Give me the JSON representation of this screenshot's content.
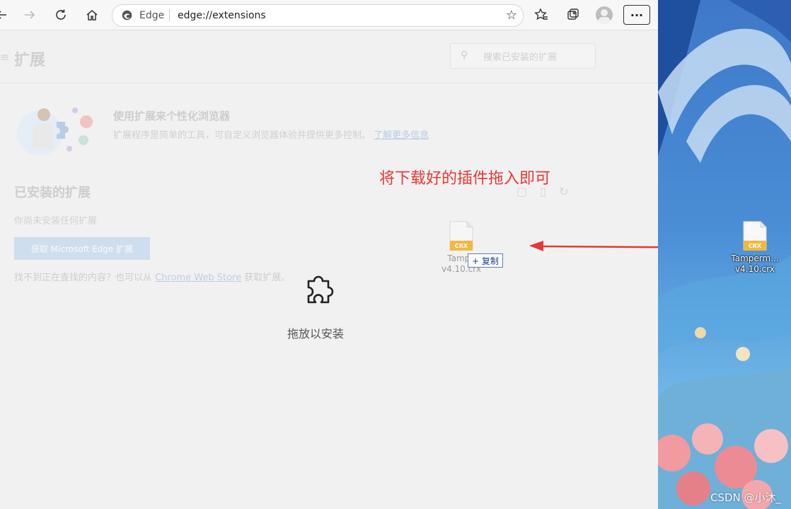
{
  "toolbar": {
    "edge_label": "Edge",
    "url": "edge://extensions",
    "more_label": "···"
  },
  "page": {
    "title": "扩展",
    "search_placeholder": "搜索已安装的扩展",
    "promo_title": "使用扩展来个性化浏览器",
    "promo_desc": "扩展程序是简单的工具，可自定义浏览器体验并提供更多控制。",
    "promo_link": "了解更多信息",
    "installed_title": "已安装的扩展",
    "none_installed": "你尚未安装任何扩展",
    "get_button": "获取 Microsoft Edge 扩展",
    "cant_find_prefix": "找不到正在查找的内容？也可以从",
    "cant_find_link": "Chrome Web Store",
    "cant_find_suffix": "获取扩展。"
  },
  "drop": {
    "label": "拖放以安装"
  },
  "annotation": {
    "text": "将下载好的插件拖入即可",
    "color": "#e53935"
  },
  "drag_file": {
    "badge": "CRX",
    "name_line1": "Tampe",
    "name_line2": "v4.10.crx",
    "copy_label": "+ 复制"
  },
  "desktop_file": {
    "badge": "CRX",
    "name_line1": "Tamperm...",
    "name_line2": "v4.10.crx"
  },
  "watermark": "CSDN @小沐_"
}
